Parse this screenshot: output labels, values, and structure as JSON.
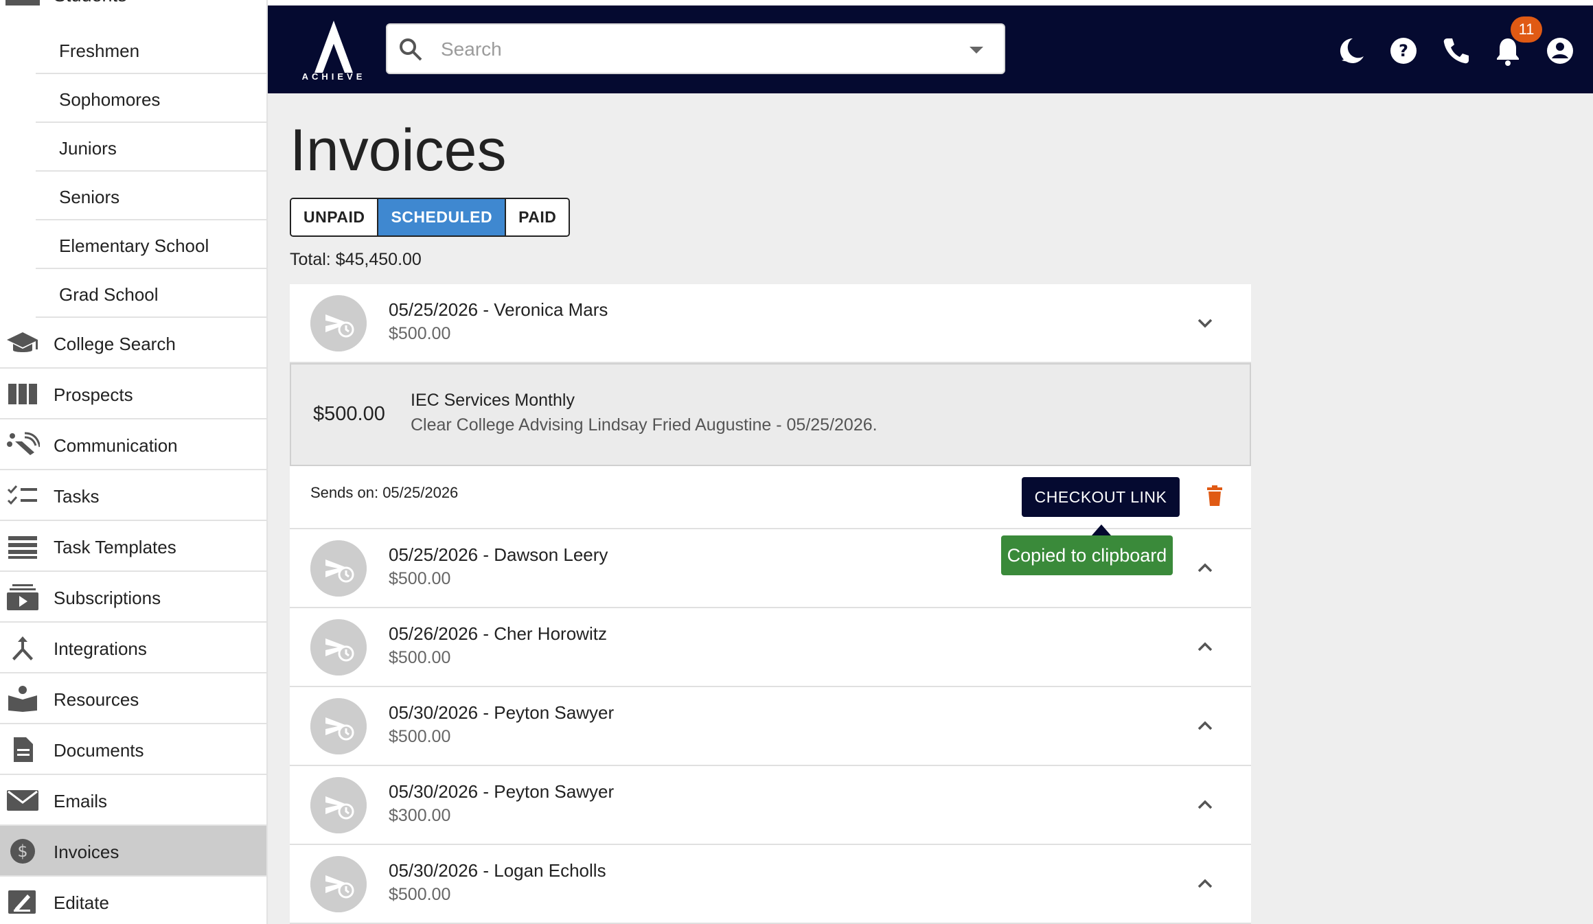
{
  "sidebar": {
    "partial_top_label": "Students",
    "sub_items": [
      "Freshmen",
      "Sophomores",
      "Juniors",
      "Seniors",
      "Elementary School",
      "Grad School"
    ],
    "items": [
      {
        "label": "College Search",
        "icon": "graduation-cap-icon"
      },
      {
        "label": "Prospects",
        "icon": "columns-icon"
      },
      {
        "label": "Communication",
        "icon": "communication-icon"
      },
      {
        "label": "Tasks",
        "icon": "checklist-icon"
      },
      {
        "label": "Task Templates",
        "icon": "list-icon"
      },
      {
        "label": "Subscriptions",
        "icon": "subscriptions-icon"
      },
      {
        "label": "Integrations",
        "icon": "merge-icon"
      },
      {
        "label": "Resources",
        "icon": "book-icon"
      },
      {
        "label": "Documents",
        "icon": "document-icon"
      },
      {
        "label": "Emails",
        "icon": "envelope-icon"
      },
      {
        "label": "Invoices",
        "icon": "dollar-icon",
        "active": true
      },
      {
        "label": "Editate",
        "icon": "edit-icon"
      }
    ]
  },
  "header": {
    "logo_text": "ACHIEVE",
    "search_placeholder": "Search",
    "notification_count": "11",
    "colors": {
      "bar": "#050a30",
      "badge": "#e05a14"
    }
  },
  "main": {
    "title": "Invoices",
    "tabs": [
      {
        "label": "UNPAID"
      },
      {
        "label": "SCHEDULED",
        "active": true
      },
      {
        "label": "PAID"
      }
    ],
    "total": "Total: $45,450.00",
    "invoices": [
      {
        "title": "05/25/2026 - Veronica Mars",
        "amount": "$500.00",
        "expanded": true
      },
      {
        "title": "05/25/2026 - Dawson Leery",
        "amount": "$500.00"
      },
      {
        "title": "05/26/2026 - Cher Horowitz",
        "amount": "$500.00"
      },
      {
        "title": "05/30/2026 - Peyton Sawyer",
        "amount": "$500.00"
      },
      {
        "title": "05/30/2026 - Peyton Sawyer",
        "amount": "$300.00"
      },
      {
        "title": "05/30/2026 - Logan Echolls",
        "amount": "$500.00"
      }
    ],
    "detail": {
      "amount": "$500.00",
      "title": "IEC Services Monthly",
      "description": "Clear College Advising Lindsay Fried Augustine - 05/25/2026."
    },
    "sends_on": "Sends on: 05/25/2026",
    "checkout_label": "CHECKOUT LINK",
    "tooltip": "Copied to clipboard",
    "colors": {
      "active_tab": "#3f88d0",
      "tooltip": "#3a8a3a",
      "trash": "#e05a14"
    }
  }
}
